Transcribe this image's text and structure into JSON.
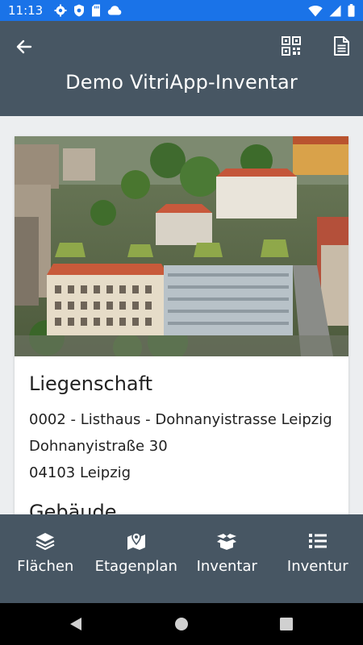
{
  "status_bar": {
    "time": "11:13",
    "icons": [
      "gear-icon",
      "shield-icon",
      "sd-card-icon",
      "cloud-icon",
      "wifi-icon",
      "cell-signal-icon",
      "battery-icon"
    ]
  },
  "app_bar": {
    "title": "Demo VitriApp-Inventar",
    "back_icon": "arrow-back-icon",
    "actions": [
      "qr-code-icon",
      "document-icon"
    ],
    "color": "#475663"
  },
  "property_card": {
    "image_alt": "Luftbild Listhaus Leipzig",
    "title": "Liegenschaft",
    "lines": [
      "0002 - Listhaus - Dohnanyistrasse Leipzig",
      "Dohnanyistraße 30",
      "04103 Leipzig"
    ],
    "next_section_title": "Gebäude"
  },
  "bottom_nav": {
    "items": [
      {
        "label": "Flächen",
        "icon": "layers-icon"
      },
      {
        "label": "Etagenplan",
        "icon": "map-marker-icon"
      },
      {
        "label": "Inventar",
        "icon": "box-open-icon"
      },
      {
        "label": "Inventur",
        "icon": "list-icon"
      }
    ]
  },
  "colors": {
    "status_bar": "#1a73e8",
    "primary": "#475663",
    "background": "#eceef0"
  }
}
